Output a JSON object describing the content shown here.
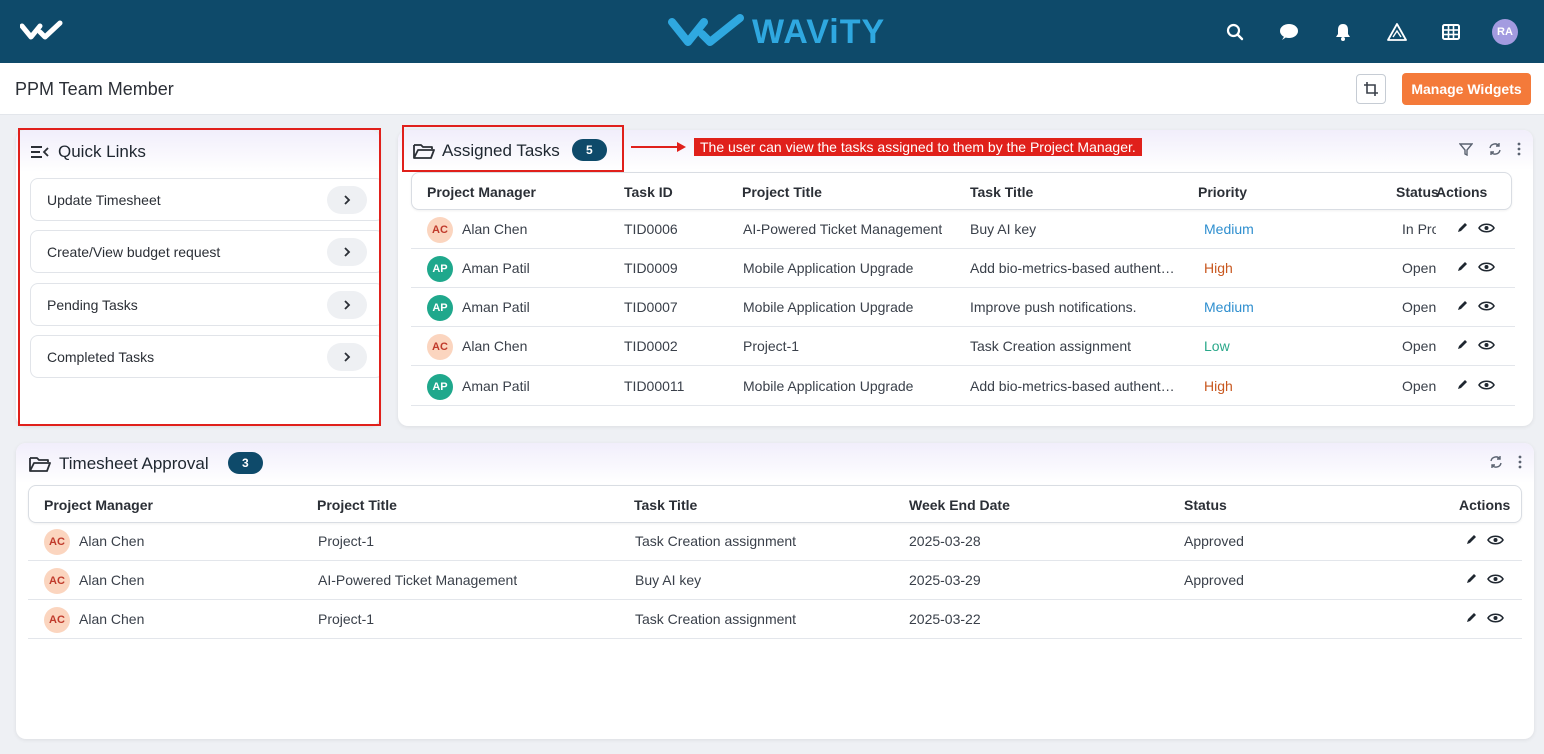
{
  "brand": {
    "name": "WAViTY"
  },
  "topbar": {
    "icons": [
      "search-icon",
      "chat-icon",
      "bell-icon",
      "triangle-icon",
      "grid-icon"
    ],
    "avatar_initials": "RA"
  },
  "page": {
    "title": "PPM Team Member",
    "manage_widgets": "Manage Widgets"
  },
  "quick_links": {
    "title": "Quick Links",
    "items": [
      {
        "label": "Update Timesheet"
      },
      {
        "label": "Create/View budget request"
      },
      {
        "label": "Pending Tasks"
      },
      {
        "label": "Completed Tasks"
      }
    ]
  },
  "assigned_tasks": {
    "title": "Assigned Tasks",
    "count": "5",
    "annotation": "The user can view the tasks assigned to them by the Project Manager.",
    "columns": [
      "Project Manager",
      "Task ID",
      "Project Title",
      "Task Title",
      "Priority",
      "Status",
      "Actions"
    ],
    "rows": [
      {
        "initials": "AC",
        "manager": "Alan Chen",
        "task_id": "TID0006",
        "project": "AI-Powered Ticket Management",
        "task": "Buy AI key",
        "priority": "Medium",
        "status": "In Pro"
      },
      {
        "initials": "AP",
        "manager": "Aman Patil",
        "task_id": "TID0009",
        "project": "Mobile Application Upgrade",
        "task": "Add bio-metrics-based authent…",
        "priority": "High",
        "status": "Open"
      },
      {
        "initials": "AP",
        "manager": "Aman Patil",
        "task_id": "TID0007",
        "project": "Mobile Application Upgrade",
        "task": "Improve push notifications.",
        "priority": "Medium",
        "status": "Open"
      },
      {
        "initials": "AC",
        "manager": "Alan Chen",
        "task_id": "TID0002",
        "project": "Project-1",
        "task": "Task Creation assignment",
        "priority": "Low",
        "status": "Open"
      },
      {
        "initials": "AP",
        "manager": "Aman Patil",
        "task_id": "TID00011",
        "project": "Mobile Application Upgrade",
        "task": "Add bio-metrics-based authent…",
        "priority": "High",
        "status": "Open"
      }
    ]
  },
  "timesheet_approval": {
    "title": "Timesheet Approval",
    "count": "3",
    "columns": [
      "Project Manager",
      "Project Title",
      "Task Title",
      "Week End Date",
      "Status",
      "Actions"
    ],
    "rows": [
      {
        "initials": "AC",
        "manager": "Alan Chen",
        "project": "Project-1",
        "task": "Task Creation assignment",
        "week_end": "2025-03-28",
        "status": "Approved"
      },
      {
        "initials": "AC",
        "manager": "Alan Chen",
        "project": "AI-Powered Ticket Management",
        "task": "Buy AI key",
        "week_end": "2025-03-29",
        "status": "Approved"
      },
      {
        "initials": "AC",
        "manager": "Alan Chen",
        "project": "Project-1",
        "task": "Task Creation assignment",
        "week_end": "2025-03-22",
        "status": ""
      }
    ]
  },
  "colors": {
    "topbar": "#0e4a6a",
    "brand": "#2fa8e0",
    "accent_button": "#f47a3a",
    "priority_medium": "#2f8fcf",
    "priority_high": "#c8571e",
    "priority_low": "#2aa88a",
    "annotation": "#e0201b"
  }
}
